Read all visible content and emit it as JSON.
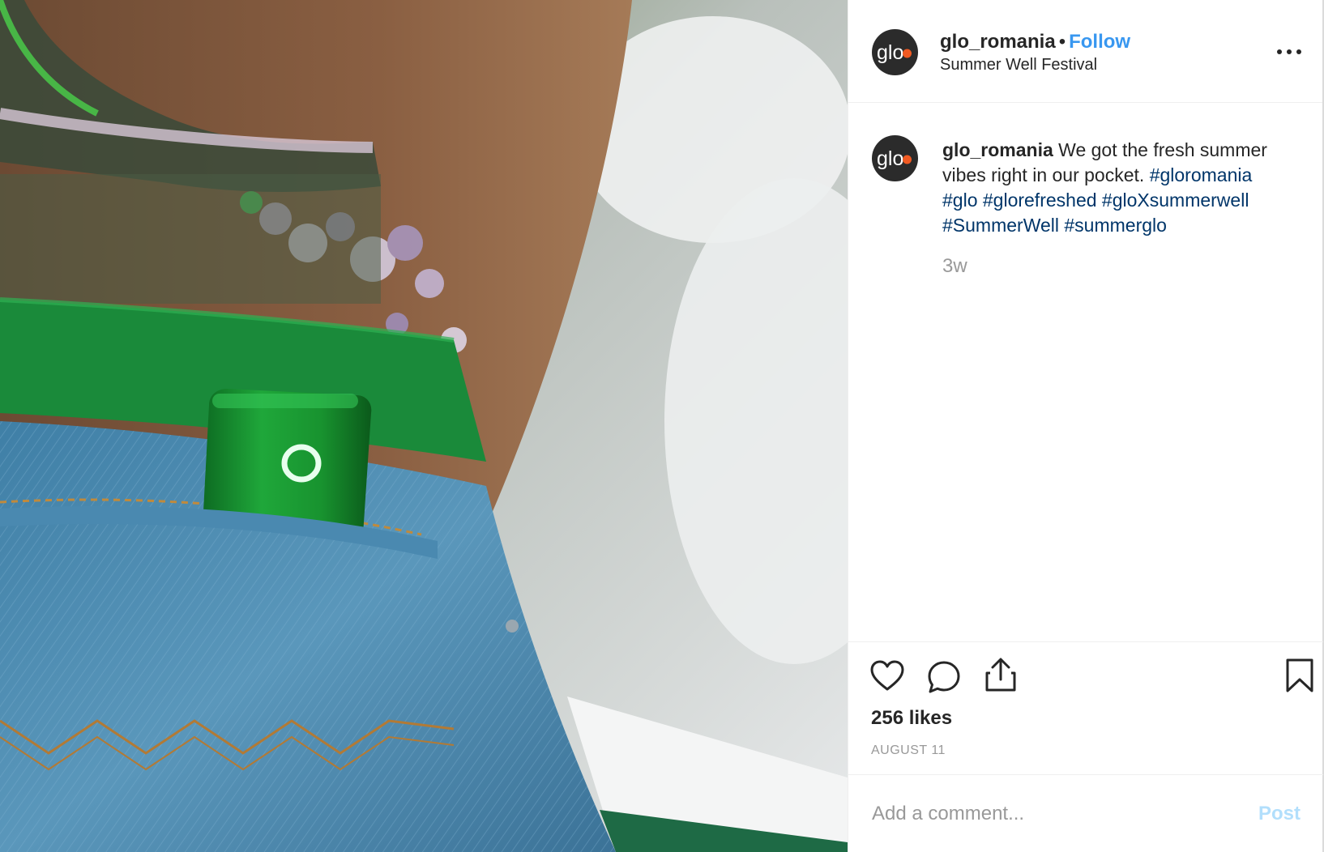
{
  "header": {
    "username": "glo_romania",
    "separator": "•",
    "follow_label": "Follow",
    "location": "Summer Well Festival",
    "more_icon": "more-horizontal-icon"
  },
  "avatar": {
    "logo_text": "glo",
    "logo_dot_color": "#f15a22",
    "background": "#2b2b2b"
  },
  "caption": {
    "username": "glo_romania",
    "text": "We got the fresh summer vibes right in our pocket.",
    "hashtags": [
      "#gloromania",
      "#glo",
      "#glorefreshed",
      "#gloXsummerwell",
      "#SummerWell",
      "#summerglo"
    ],
    "age": "3w"
  },
  "actions": {
    "like_icon": "heart-icon",
    "comment_icon": "comment-icon",
    "share_icon": "share-icon",
    "save_icon": "bookmark-icon",
    "likes": "256 likes",
    "date": "AUGUST 11"
  },
  "comment": {
    "placeholder": "Add a comment...",
    "value": "",
    "post_label": "Post"
  },
  "colors": {
    "link": "#3897f0",
    "hashtag": "#003569",
    "muted": "#999999",
    "post_disabled": "#b2dffc"
  },
  "photo": {
    "subject": "green glo device in back pocket of denim jeans"
  }
}
